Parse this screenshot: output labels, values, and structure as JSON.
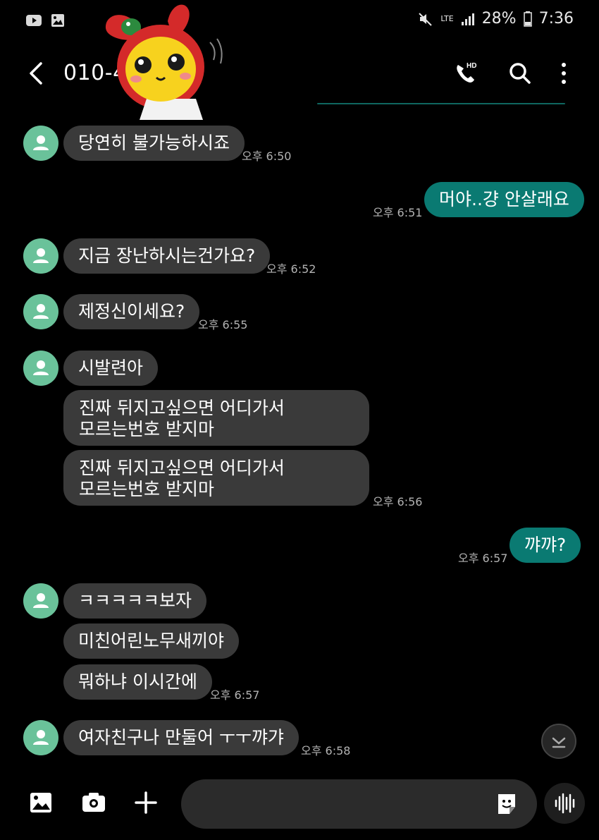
{
  "status": {
    "network": "LTE",
    "battery": "28%",
    "time": "7:36"
  },
  "header": {
    "contact": "010-4       0"
  },
  "messages": [
    {
      "dir": "in",
      "text": "당연히 불가능하시죠",
      "time": "오후 6:50"
    },
    {
      "dir": "out",
      "text": "머야..걍 안살래요",
      "time": "오후 6:51"
    },
    {
      "dir": "in",
      "text": "지금 장난하시는건가요?",
      "time": "오후 6:52"
    },
    {
      "dir": "in",
      "text": "제정신이세요?",
      "time": "오후 6:55"
    },
    {
      "dir": "in",
      "text": "시발련아",
      "time": ""
    },
    {
      "dir": "in",
      "line1": "진짜 뒤지고싶으면 어디가서",
      "line2": "모르는번호 받지마",
      "time": ""
    },
    {
      "dir": "in",
      "line1": "진짜 뒤지고싶으면 어디가서",
      "line2": "모르는번호 받지마",
      "time": "오후 6:56"
    },
    {
      "dir": "out",
      "text": "꺄꺄?",
      "time": "오후 6:57"
    },
    {
      "dir": "in",
      "text": "ㅋㅋㅋㅋㅋ보자",
      "time": ""
    },
    {
      "dir": "in",
      "text": "미친어린노무새끼야",
      "time": ""
    },
    {
      "dir": "in",
      "text": "뭐하냐 이시간에",
      "time": "오후 6:57"
    },
    {
      "dir": "in",
      "text": "여자친구나 만둘어 ㅜㅜ꺄갸",
      "time": "오후 6:58"
    }
  ],
  "colors": {
    "background": "#000000",
    "incoming_bubble": "#3a3a3a",
    "outgoing_bubble": "#0a7a72",
    "avatar": "#6ac29a"
  }
}
